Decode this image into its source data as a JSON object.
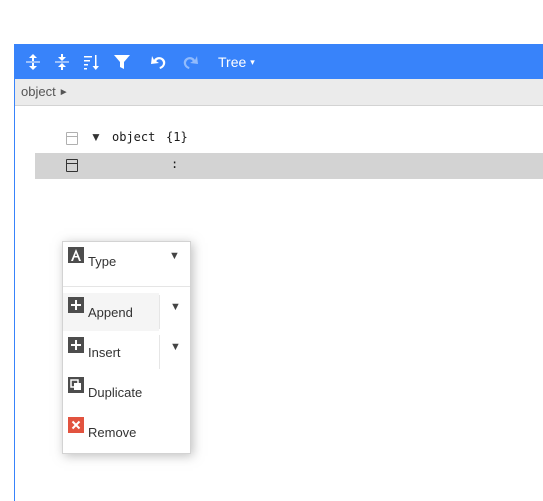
{
  "toolbar": {
    "buttons": [
      {
        "name": "expand-all-icon"
      },
      {
        "name": "collapse-all-icon"
      },
      {
        "name": "sort-icon"
      },
      {
        "name": "filter-icon"
      },
      {
        "name": "undo-icon"
      },
      {
        "name": "redo-icon"
      }
    ],
    "mode_label": "Tree",
    "mode_caret": "▾"
  },
  "navbar": {
    "breadcrumb": "object",
    "arrow": "►"
  },
  "tree": {
    "root": {
      "expander": "▼",
      "field": "object",
      "count": "{1}"
    },
    "child": {
      "separator": ":"
    }
  },
  "context_menu": {
    "type_label": "Type",
    "append_label": "Append",
    "insert_label": "Insert",
    "duplicate_label": "Duplicate",
    "remove_label": "Remove",
    "submenu_arrow": "▼"
  },
  "colors": {
    "accent": "#3883fa",
    "selected_row": "#d3d3d3",
    "remove_icon": "#e2533f"
  }
}
